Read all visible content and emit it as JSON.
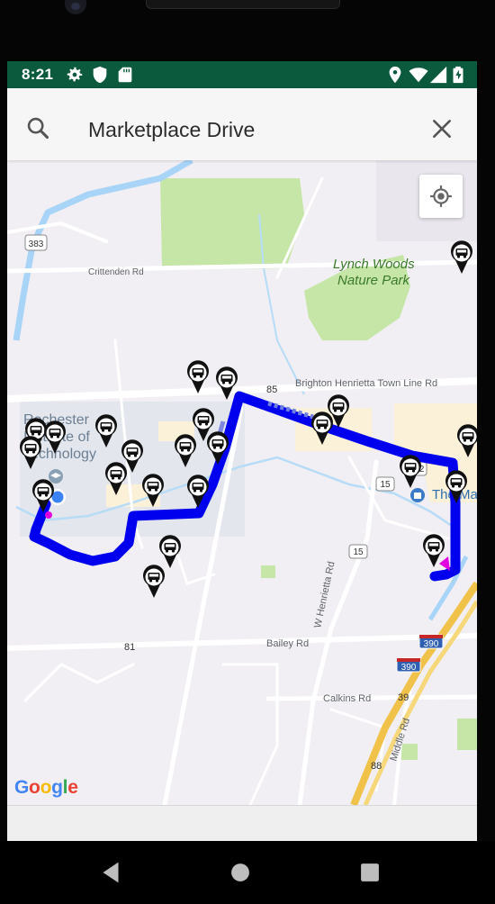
{
  "status_bar": {
    "time": "8:21",
    "left_icons": [
      "gear-icon",
      "shield-icon",
      "sd-card-icon"
    ],
    "right_icons": [
      "location-icon",
      "wifi-icon",
      "cell-signal-icon",
      "battery-charging-icon"
    ],
    "background_color": "#0b5a3e"
  },
  "search": {
    "value": "Marketplace Drive",
    "search_icon": "search-icon",
    "clear_icon": "close-icon"
  },
  "map": {
    "labels": {
      "road_crittenden": "Crittenden Rd",
      "park": "Lynch Woods\nNature Park",
      "park_line1": "Lynch Woods",
      "park_line2": "Nature Park",
      "road_brighton": "Brighton Henrietta Town Line Rd",
      "campus": "Rochester Institute of Technology",
      "campus_line1": "Rochester",
      "campus_line2": "Institute of",
      "campus_line3": "Technology",
      "road_bailey": "Bailey Rd",
      "road_henrietta": "W Henrietta Rd",
      "road_calkins": "Calkins Rd",
      "road_middle": "Middle Rd",
      "place_the_ma": "The Ma",
      "shield_383": "383",
      "shield_85": "85",
      "shield_252": "252",
      "shield_15a": "15",
      "shield_15b": "15",
      "shield_81": "81",
      "shield_390a": "390",
      "shield_390b": "390",
      "shield_39": "39",
      "shield_88": "88"
    },
    "route_color": "#0000ee",
    "bus_stop_count": 26,
    "my_location_button_icon": "my-location-icon",
    "google_logo": "Google"
  },
  "nav_bar": {
    "buttons": [
      "back-icon",
      "home-icon",
      "recents-icon"
    ]
  }
}
